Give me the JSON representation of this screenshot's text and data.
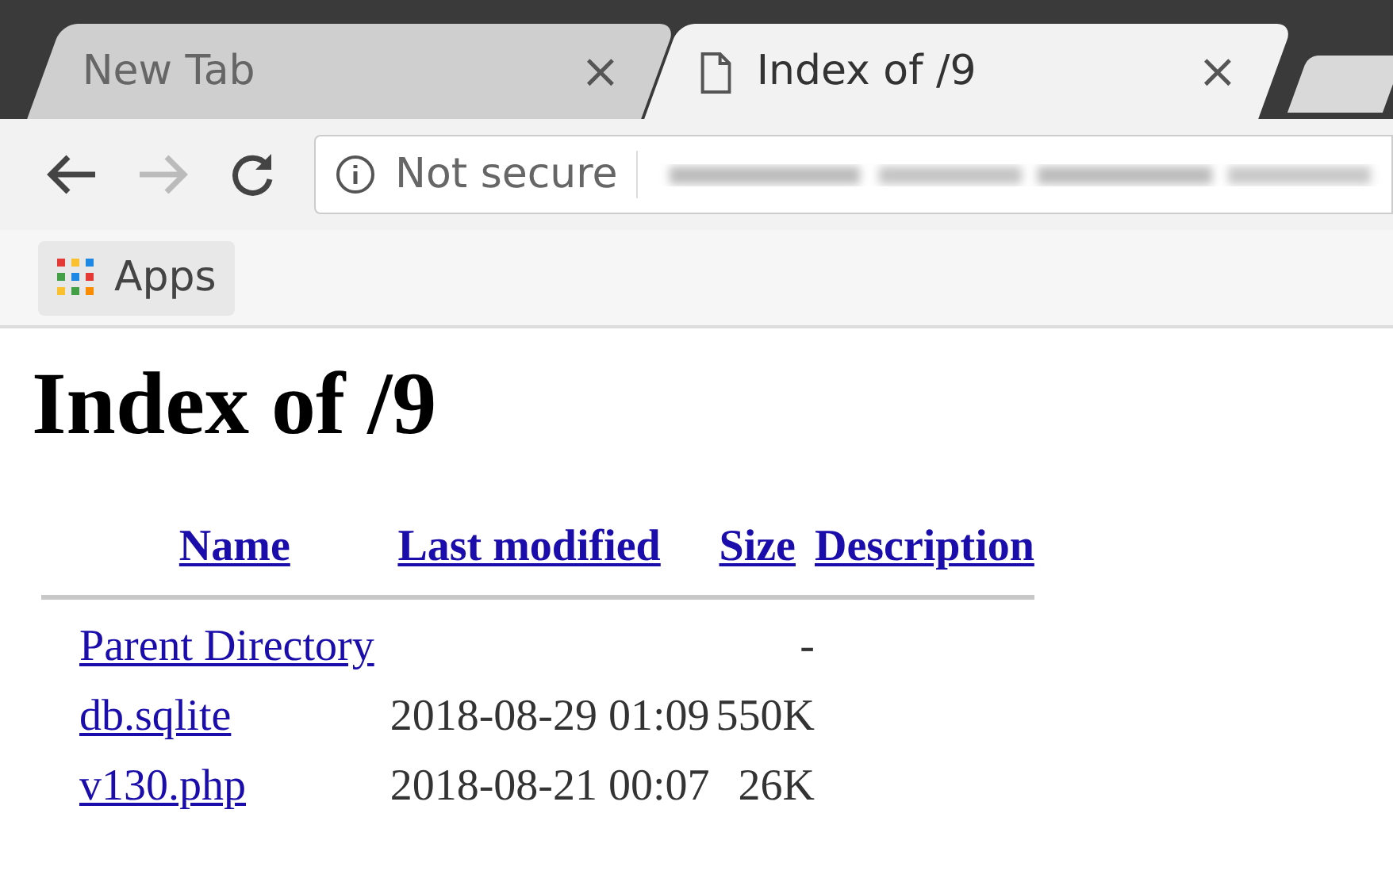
{
  "tabs": [
    {
      "title": "New Tab",
      "selected": false,
      "close": "×"
    },
    {
      "title": "Index of /9",
      "selected": true,
      "close": "×"
    }
  ],
  "toolbar": {
    "security_label": "Not secure"
  },
  "bookmarks": [
    {
      "label": "Apps"
    }
  ],
  "page": {
    "heading": "Index of /9",
    "columns": [
      "Name",
      "Last modified",
      "Size",
      "Description"
    ],
    "rows": [
      {
        "name": "Parent Directory",
        "modified": "",
        "size": "-"
      },
      {
        "name": "db.sqlite",
        "modified": "2018-08-29 01:09",
        "size": "550K"
      },
      {
        "name": "v130.php",
        "modified": "2018-08-21 00:07",
        "size": "26K"
      }
    ]
  }
}
